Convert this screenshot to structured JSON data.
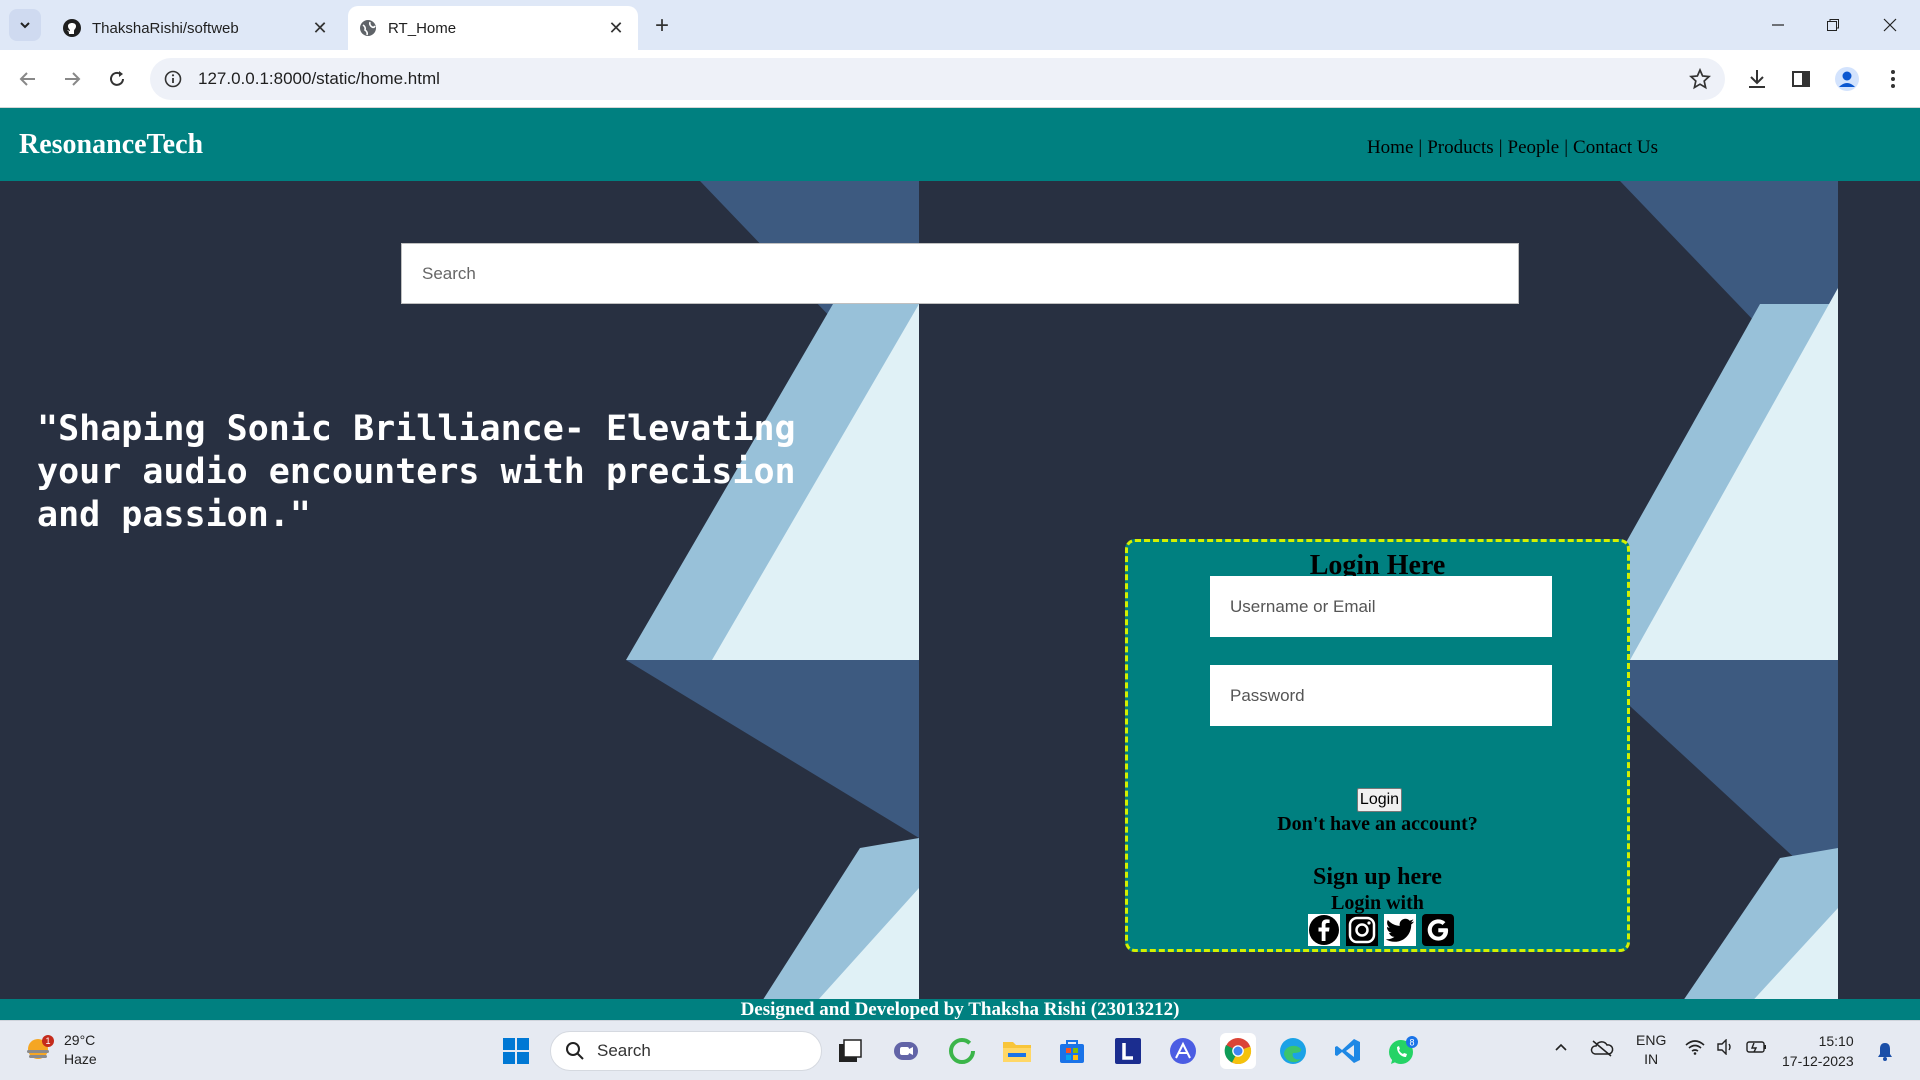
{
  "browser": {
    "tabs": [
      {
        "title": "ThakshaRishi/softweb",
        "active": false,
        "icon": "github-icon"
      },
      {
        "title": "RT_Home",
        "active": true,
        "icon": "globe-icon"
      }
    ],
    "url": "127.0.0.1:8000/static/home.html"
  },
  "site": {
    "brand": "ResonanceTech",
    "nav": [
      {
        "label": "Home"
      },
      {
        "label": "Products"
      },
      {
        "label": "People"
      },
      {
        "label": "Contact Us"
      }
    ],
    "nav_separator": "|",
    "search_placeholder": "Search",
    "tagline": "\"Shaping Sonic Brilliance- Elevating your audio encounters with precision and passion.\"",
    "login": {
      "title": "Login Here",
      "username_placeholder": "Username or Email",
      "password_placeholder": "Password",
      "button": "Login",
      "no_account": "Don't have an account?",
      "signup": "Sign up here",
      "login_with": "Login with",
      "socials": [
        "facebook-icon",
        "instagram-icon",
        "twitter-icon",
        "google-icon"
      ]
    },
    "footer": "Designed and Developed by Thaksha Rishi (23013212)",
    "colors": {
      "header": "#008080",
      "background": "#283041",
      "login_border": "#d4f000"
    }
  },
  "taskbar": {
    "weather_temp": "29°C",
    "weather_desc": "Haze",
    "weather_badge": "1",
    "search_label": "Search",
    "whatsapp_badge": "8",
    "lang_top": "ENG",
    "lang_bottom": "IN",
    "time": "15:10",
    "date": "17-12-2023"
  }
}
